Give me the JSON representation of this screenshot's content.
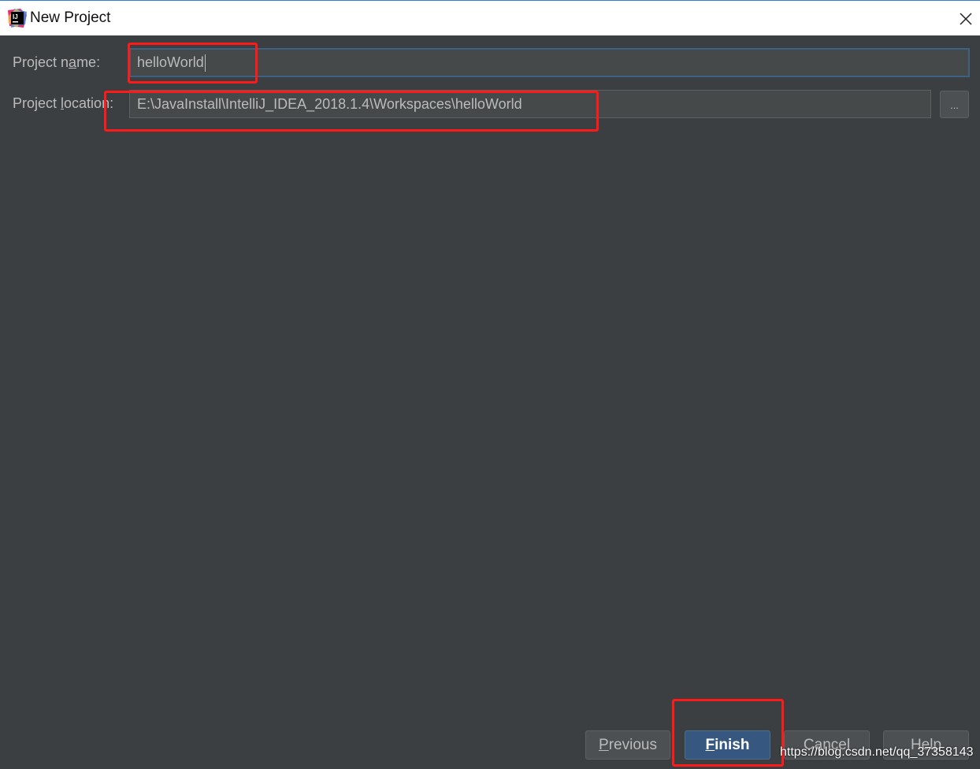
{
  "window": {
    "title": "New Project",
    "app_icon": "intellij-idea-icon",
    "close_icon": "close-icon"
  },
  "form": {
    "project_name": {
      "label_pre": "Project n",
      "label_mnemonic": "a",
      "label_post": "me:",
      "value": "helloWorld"
    },
    "project_location": {
      "label_pre": "Project ",
      "label_mnemonic": "l",
      "label_post": "ocation:",
      "value": "E:\\JavaInstall\\IntelliJ_IDEA_2018.1.4\\Workspaces\\helloWorld",
      "browse_label": "..."
    }
  },
  "buttons": {
    "previous": {
      "mnemonic": "P",
      "rest": "revious"
    },
    "finish": {
      "mnemonic": "F",
      "rest": "inish"
    },
    "cancel": {
      "mnemonic": "",
      "rest": "Cancel"
    },
    "help": {
      "mnemonic": "",
      "rest": "Help"
    }
  },
  "watermark": "https://blog.csdn.net/qq_37358143",
  "colors": {
    "annotation": "#ff1a1a",
    "primary_button": "#365880",
    "background": "#3c3f41"
  }
}
